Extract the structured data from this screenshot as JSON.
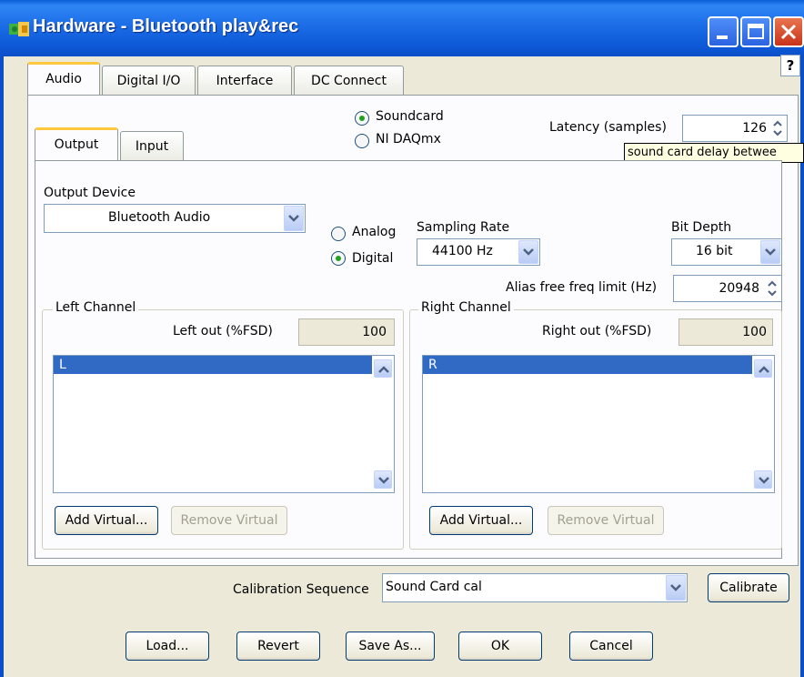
{
  "window": {
    "title": "Hardware  - Bluetooth play&rec",
    "help": "?"
  },
  "main_tabs": [
    "Audio",
    "Digital I/O",
    "Interface",
    "DC Connect"
  ],
  "sub_tabs": [
    "Output",
    "Input"
  ],
  "source": {
    "soundcard": "Soundcard",
    "daqmx": "NI DAQmx",
    "selected": "Soundcard"
  },
  "latency": {
    "label": "Latency (samples)",
    "value": "126",
    "tooltip": "sound card delay betwee"
  },
  "output_device": {
    "label": "Output Device",
    "value": "Bluetooth Audio"
  },
  "mode": {
    "analog": "Analog",
    "digital": "Digital",
    "selected": "Digital"
  },
  "sampling_rate": {
    "label": "Sampling Rate",
    "value": "44100 Hz"
  },
  "bit_depth": {
    "label": "Bit Depth",
    "value": "16 bit"
  },
  "alias": {
    "label": "Alias free freq limit (Hz)",
    "value": "20948"
  },
  "left_channel": {
    "title": "Left Channel",
    "out_label": "Left out (%FSD)",
    "out_value": "100",
    "items": [
      "L"
    ],
    "add": "Add Virtual...",
    "remove": "Remove Virtual"
  },
  "right_channel": {
    "title": "Right Channel",
    "out_label": "Right out (%FSD)",
    "out_value": "100",
    "items": [
      "R"
    ],
    "add": "Add Virtual...",
    "remove": "Remove Virtual"
  },
  "calibration": {
    "label": "Calibration Sequence",
    "value": "Sound Card cal",
    "button": "Calibrate"
  },
  "footer": {
    "load": "Load...",
    "revert": "Revert",
    "save_as": "Save As...",
    "ok": "OK",
    "cancel": "Cancel"
  }
}
